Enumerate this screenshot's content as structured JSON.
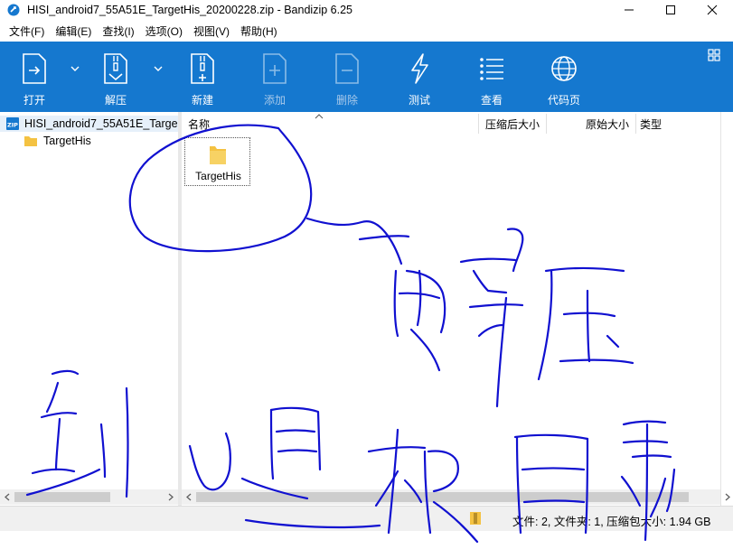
{
  "window": {
    "title": "HISI_android7_55A51E_TargetHis_20200228.zip - Bandizip 6.25"
  },
  "menu": [
    {
      "label": "文件(F)"
    },
    {
      "label": "编辑(E)"
    },
    {
      "label": "查找(I)"
    },
    {
      "label": "选项(O)"
    },
    {
      "label": "视图(V)"
    },
    {
      "label": "帮助(H)"
    }
  ],
  "toolbar": {
    "buttons": [
      {
        "label": "打开",
        "icon": "open-icon",
        "enabled": true,
        "has_dropdown": true
      },
      {
        "label": "解压",
        "icon": "extract-icon",
        "enabled": true,
        "has_dropdown": true
      },
      {
        "label": "新建",
        "icon": "new-archive-icon",
        "enabled": true,
        "has_dropdown": false
      },
      {
        "label": "添加",
        "icon": "add-file-icon",
        "enabled": false,
        "has_dropdown": false
      },
      {
        "label": "删除",
        "icon": "delete-file-icon",
        "enabled": false,
        "has_dropdown": false
      },
      {
        "label": "测试",
        "icon": "test-lightning-icon",
        "enabled": true,
        "has_dropdown": false
      },
      {
        "label": "查看",
        "icon": "view-list-icon",
        "enabled": true,
        "has_dropdown": false
      },
      {
        "label": "代码页",
        "icon": "codepage-globe-icon",
        "enabled": true,
        "has_dropdown": false
      }
    ]
  },
  "tree": {
    "root_label": "HISI_android7_55A51E_Targe",
    "child_label": "TargetHis"
  },
  "list": {
    "columns": {
      "name": "名称",
      "compressed_size": "压缩后大小",
      "original_size": "原始大小",
      "type": "类型"
    },
    "items": [
      {
        "name": "TargetHis",
        "icon": "folder-icon"
      }
    ]
  },
  "status": {
    "text": "文件: 2, 文件夹: 1, 压缩包大小: 1.94 GB"
  },
  "colors": {
    "toolbar_bg": "#1578cf",
    "folder": "#f4c242",
    "scribble_ink": "#1010d0"
  }
}
